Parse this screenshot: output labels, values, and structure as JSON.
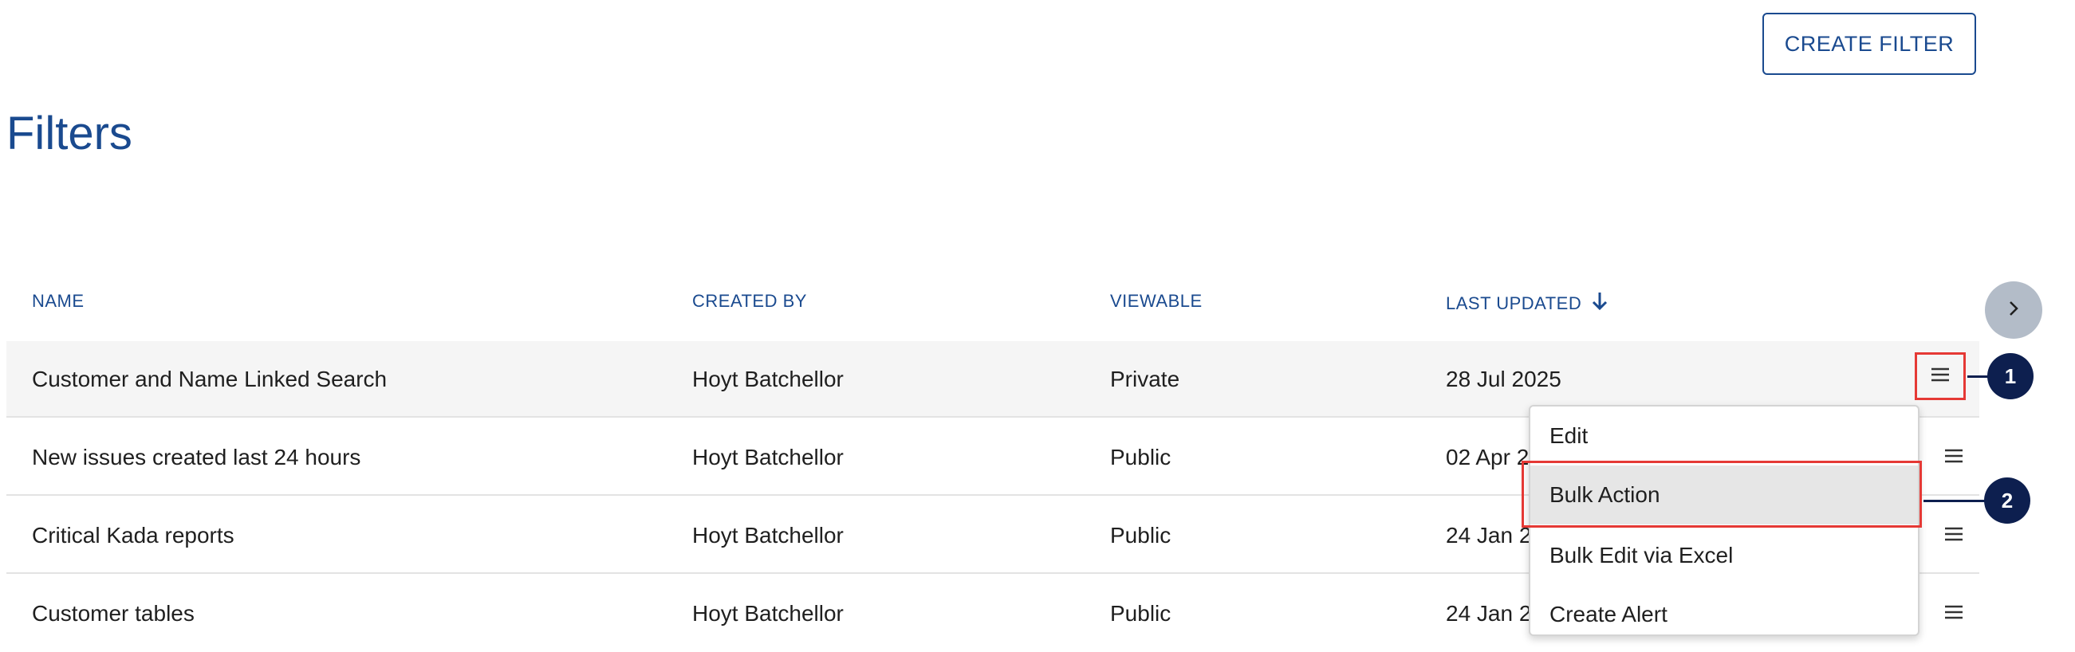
{
  "header": {
    "create_filter_label": "CREATE FILTER"
  },
  "page_title": "Filters",
  "table": {
    "columns": {
      "name": "NAME",
      "created_by": "CREATED BY",
      "viewable": "VIEWABLE",
      "last_updated": "LAST UPDATED"
    },
    "sort": {
      "column": "last_updated",
      "direction": "desc"
    },
    "rows": [
      {
        "name": "Customer and Name Linked Search",
        "created_by": "Hoyt Batchellor",
        "viewable": "Private",
        "last_updated": "28 Jul 2025"
      },
      {
        "name": "New issues created last 24 hours",
        "created_by": "Hoyt Batchellor",
        "viewable": "Public",
        "last_updated": "02 Apr 2"
      },
      {
        "name": "Critical Kada reports",
        "created_by": "Hoyt Batchellor",
        "viewable": "Public",
        "last_updated": "24 Jan 2"
      },
      {
        "name": "Customer tables",
        "created_by": "Hoyt Batchellor",
        "viewable": "Public",
        "last_updated": "24 Jan 2"
      }
    ]
  },
  "row_menu": {
    "items": [
      "Edit",
      "Bulk Action",
      "Bulk Edit via Excel",
      "Create Alert"
    ],
    "highlighted": "Bulk Action"
  },
  "callouts": [
    "1",
    "2"
  ],
  "icons": {
    "menu": "hamburger-icon",
    "scroll": "chevron-right-icon",
    "sort": "arrow-down-icon"
  },
  "colors": {
    "accent": "#1a4a8f",
    "highlight": "#e53935",
    "callout": "#0d1f4f"
  }
}
